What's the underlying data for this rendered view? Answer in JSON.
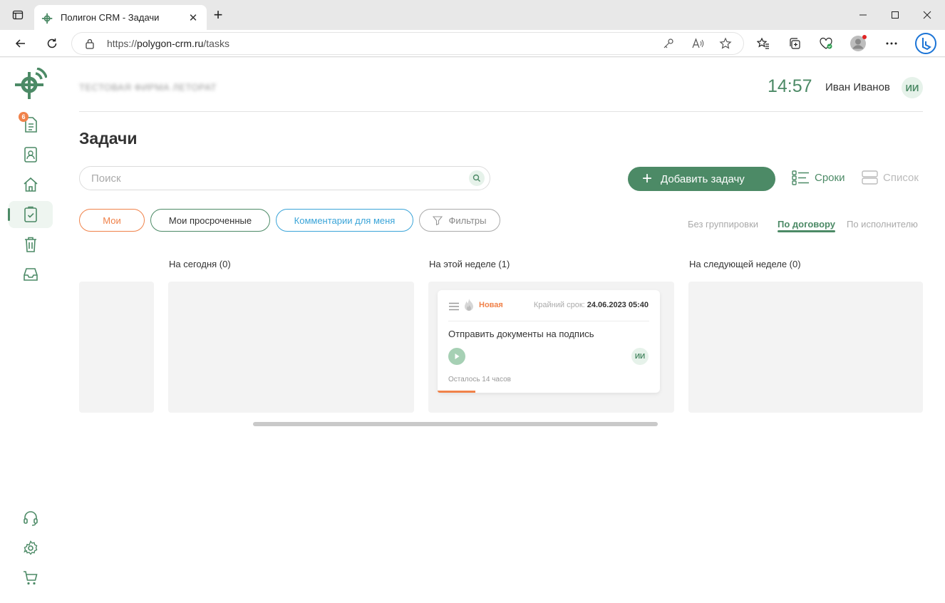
{
  "browser": {
    "tab_title": "Полигон CRM - Задачи",
    "url_prefix": "https://",
    "url_host": "polygon-crm.ru",
    "url_path": "/tasks",
    "close_symbol": "✕",
    "new_tab_symbol": "+"
  },
  "sidebar": {
    "badge_count": "6",
    "items": [
      {
        "icon": "document-icon"
      },
      {
        "icon": "contacts-icon"
      },
      {
        "icon": "home-icon"
      },
      {
        "icon": "tasks-icon",
        "active": true
      },
      {
        "icon": "trash-icon"
      },
      {
        "icon": "inbox-icon"
      }
    ],
    "bottom": [
      {
        "icon": "headset-icon"
      },
      {
        "icon": "gear-icon"
      },
      {
        "icon": "cart-icon"
      }
    ]
  },
  "header": {
    "org_name": "ТЕСТОВАЯ ФИРМА ЛЕТОРАТ",
    "clock": "14:57",
    "user_name": "Иван Иванов",
    "user_initials": "ИИ"
  },
  "page": {
    "title": "Задачи",
    "search_placeholder": "Поиск",
    "add_button": "Добавить задачу",
    "view_deadlines": "Сроки",
    "view_list": "Список"
  },
  "filters": {
    "mine": "Мои",
    "overdue": "Мои просроченные",
    "comments": "Комментарии для меня",
    "filters": "Фильтры"
  },
  "grouping": {
    "none": "Без группировки",
    "contract": "По договору",
    "assignee": "По исполнителю",
    "active": "contract"
  },
  "columns": [
    {
      "title": "На сегодня (0)"
    },
    {
      "title": "На этой неделе (1)"
    },
    {
      "title": "На следующей неделе (0)"
    }
  ],
  "task_card": {
    "status": "Новая",
    "deadline_label": "Крайний срок:",
    "deadline_value": "24.06.2023 05:40",
    "title": "Отправить документы на подпись",
    "assignee_initials": "ИИ",
    "remaining": "Осталось 14 часов",
    "progress": 0.17
  },
  "colors": {
    "accent": "#4c8a66",
    "orange": "#f0824a",
    "blue": "#3aa4d8"
  }
}
